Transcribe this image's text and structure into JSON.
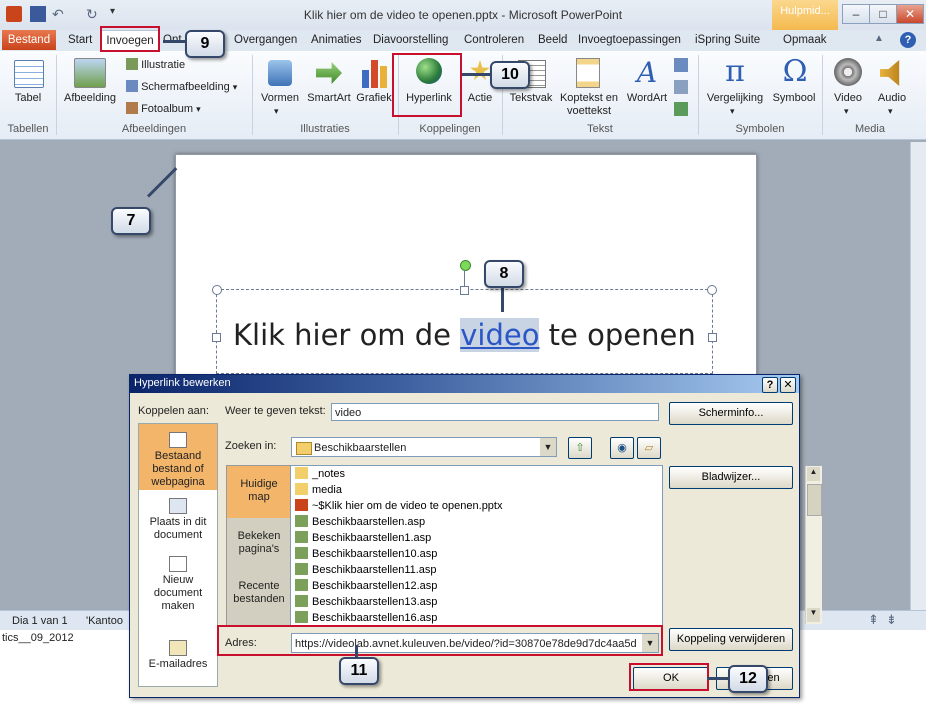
{
  "window": {
    "title": "Klik hier om de  video te openen.pptx - Microsoft PowerPoint",
    "context_tab_label": "Hulpmid...",
    "minimize": "–",
    "maximize": "□",
    "close": "✕"
  },
  "tabs": {
    "file": "Bestand",
    "items": [
      "Start",
      "Invoegen",
      "Ont",
      "Overgangen",
      "Animaties",
      "Diavoorstelling",
      "Controleren",
      "Beeld",
      "Invoegtoepassingen",
      "iSpring Suite",
      "Opmaak"
    ]
  },
  "ribbon": {
    "tabel": "Tabel",
    "afbeelding": "Afbeelding",
    "illustratie": "Illustratie",
    "schermafbeelding": "Schermafbeelding",
    "fotoalbum": "Fotoalbum",
    "vormen": "Vormen",
    "smartart": "SmartArt",
    "grafiek": "Grafiek",
    "hyperlink": "Hyperlink",
    "actie": "Actie",
    "tekstvak": "Tekstvak",
    "koptekst_1": "Koptekst en",
    "koptekst_2": "voettekst",
    "wordart": "WordArt",
    "vergelijking": "Vergelijking",
    "symbool": "Symbool",
    "video": "Video",
    "audio": "Audio",
    "groups": [
      "Tabellen",
      "Afbeeldingen",
      "Illustraties",
      "Koppelingen",
      "Tekst",
      "Symbolen",
      "Media"
    ]
  },
  "slide": {
    "text_before": "Klik hier om de ",
    "link_text": "video",
    "text_after": " te openen"
  },
  "status": {
    "slide_info": "Dia 1 van 1",
    "theme": "'Kantoo",
    "notes_text": "tics__09_2012"
  },
  "dialog": {
    "title": "Hyperlink bewerken",
    "help": "?",
    "close": "✕",
    "link_to_label": "Koppelen aan:",
    "display_text_label": "Weer te geven tekst:",
    "display_text_value": "video",
    "screentip_button": "Scherminfo...",
    "look_in_label": "Zoeken in:",
    "look_in_value": "Beschikbaarstellen",
    "bookmark_button": "Bladwijzer...",
    "remove_link_button": "Koppeling verwijderen",
    "address_label": "Adres:",
    "address_value": "https://videolab.avnet.kuleuven.be/video/?id=30870e78de9d7dc4aa5d",
    "ok_button": "OK",
    "cancel_button": "Annuleren",
    "left_items": [
      {
        "l1": "Bestaand",
        "l2": "bestand of",
        "l3": "webpagina"
      },
      {
        "l1": "Plaats in dit",
        "l2": "document",
        "l3": ""
      },
      {
        "l1": "Nieuw",
        "l2": "document",
        "l3": "maken"
      },
      {
        "l1": "E-mailadres",
        "l2": "",
        "l3": ""
      }
    ],
    "sub_items": [
      {
        "l1": "Huidige",
        "l2": "map"
      },
      {
        "l1": "Bekeken",
        "l2": "pagina's"
      },
      {
        "l1": "Recente",
        "l2": "bestanden"
      }
    ],
    "files": [
      "_notes",
      "media",
      "~$Klik hier om de  video te openen.pptx",
      "Beschikbaarstellen.asp",
      "Beschikbaarstellen1.asp",
      "Beschikbaarstellen10.asp",
      "Beschikbaarstellen11.asp",
      "Beschikbaarstellen12.asp",
      "Beschikbaarstellen13.asp",
      "Beschikbaarstellen16.asp"
    ]
  },
  "callouts": [
    "7",
    "8",
    "9",
    "10",
    "11",
    "12"
  ],
  "colors": {
    "file_tab": "#d4572c",
    "highlight_red": "#c8102e",
    "dialog_title": "#0a246a",
    "link": "#2a56c6"
  }
}
